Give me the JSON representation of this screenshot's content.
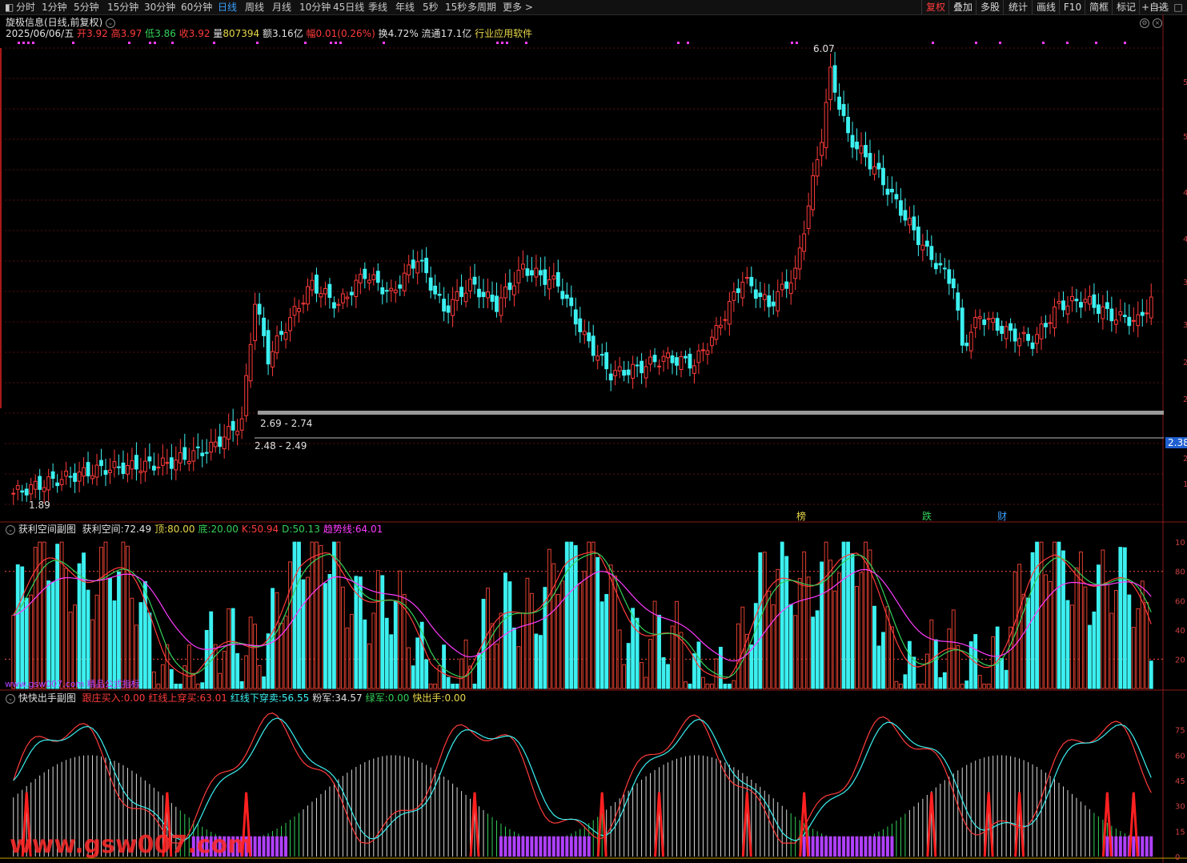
{
  "toolbar": {
    "periods": [
      "分时",
      "1分钟",
      "5分钟",
      "15分钟",
      "30分钟",
      "60分钟",
      "日线",
      "周线",
      "月线",
      "10分钟",
      "45日线",
      "季线",
      "年线",
      "5秒",
      "15秒",
      "多周期",
      "更多 >"
    ],
    "active_period": "日线",
    "right_buttons": [
      "复权",
      "叠加",
      "多股",
      "统计",
      "画线",
      "F10",
      "简框",
      "标记",
      "+自选"
    ],
    "active_right": "复权",
    "window_buttons": [
      "—",
      "□"
    ]
  },
  "stock": {
    "title": "旋极信息(日线,前复权)",
    "date": "2025/06/06/五",
    "open_label": "开",
    "open": "3.92",
    "high_label": "高",
    "high": "3.97",
    "low_label": "低",
    "low": "3.86",
    "close_label": "收",
    "close": "3.92",
    "volume_label": "量",
    "volume": "807394",
    "amount_label": "额",
    "amount": "3.16亿",
    "change_label": "幅",
    "change": "0.01(0.26%)",
    "turnover_label": "换",
    "turnover": "4.72%",
    "float_label": "流通",
    "float": "17.1亿",
    "industry": "行业应用软件"
  },
  "main_chart": {
    "price_max_label": "6.07",
    "price_min_label": "1.89",
    "zone_upper_label": "2.69 - 2.74",
    "zone_lower_label": "2.48 - 2.49",
    "current_price_tag": "2.38",
    "y_axis_ticks": [
      "5",
      "5",
      "4",
      "4",
      "3",
      "3",
      "2",
      "2",
      "2",
      "1"
    ],
    "markers": [
      {
        "text": "榜",
        "color": "#e8d84a"
      },
      {
        "text": "跌",
        "color": "#34d058"
      },
      {
        "text": "财",
        "color": "#3aa0ff"
      }
    ],
    "colors": {
      "up": "#ff3b3b",
      "down": "#3cf0f0",
      "zone": "#9a9a9a",
      "dots": "#ff3cff"
    }
  },
  "panel1": {
    "name": "获利空间副图",
    "items": [
      {
        "label": "获利空间:",
        "value": "72.49",
        "color": "#e0e0e0"
      },
      {
        "label": "顶:",
        "value": "80.00",
        "color": "#e8d84a"
      },
      {
        "label": "底:",
        "value": "20.00",
        "color": "#34d058"
      },
      {
        "label": "K:",
        "value": "50.94",
        "color": "#ff3b3b"
      },
      {
        "label": "D:",
        "value": "50.13",
        "color": "#34d058"
      },
      {
        "label": "趋势线:",
        "value": "64.01",
        "color": "#ff3cff"
      }
    ],
    "y_axis_ticks": [
      "10",
      "80",
      "60",
      "40",
      "20"
    ],
    "watermark": "www.gsw007.com 精品公式指标"
  },
  "panel2": {
    "name": "快快出手副图",
    "items": [
      {
        "label": "跟庄买入:",
        "value": "0.00",
        "color": "#ff3b3b"
      },
      {
        "label": "红线上穿买:",
        "value": "63.01",
        "color": "#ff3b3b"
      },
      {
        "label": "红线下穿卖:",
        "value": "56.55",
        "color": "#3cf0f0"
      },
      {
        "label": "粉军:",
        "value": "34.57",
        "color": "#e0e0e0"
      },
      {
        "label": "绿军:",
        "value": "0.00",
        "color": "#34d058"
      },
      {
        "label": "快出手:",
        "value": "0.00",
        "color": "#e8d84a"
      }
    ],
    "y_axis_ticks": [
      "75",
      "60",
      "45",
      "30",
      "15",
      "0"
    ],
    "watermark": "www.gsw007.com"
  }
}
